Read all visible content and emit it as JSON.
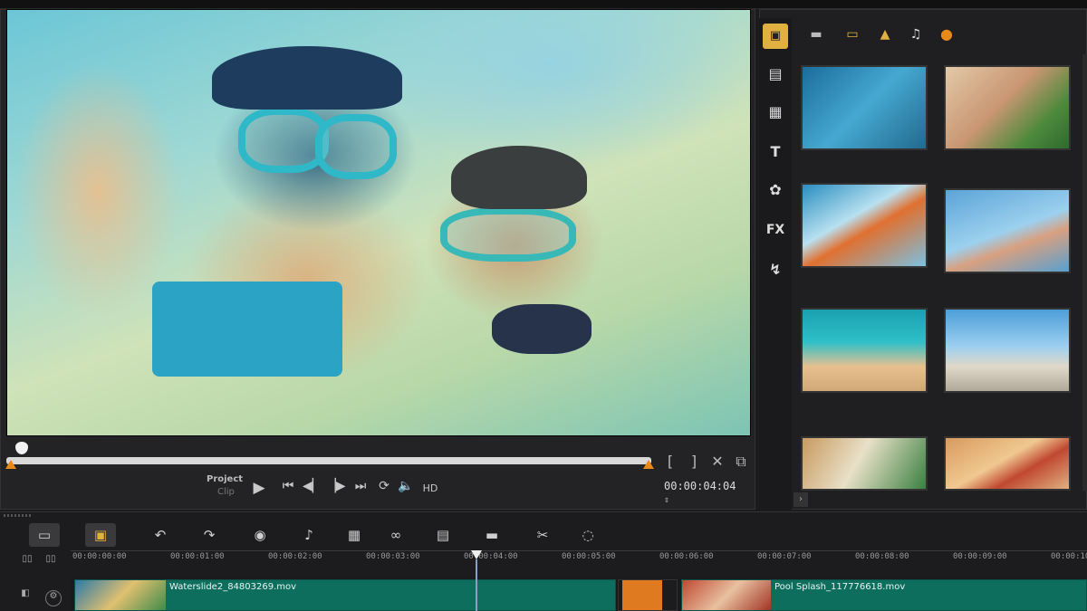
{
  "player": {
    "mode_project": "Project",
    "mode_clip": "Clip",
    "timecode": "00:00:04:04",
    "mark_in": "[",
    "mark_out": "]",
    "quality": "HD"
  },
  "library": {
    "side_fx_label": "FX",
    "side_title_label": "T",
    "thumbnails": [
      {
        "caption": ""
      },
      {
        "caption": ""
      },
      {
        "caption": ""
      },
      {
        "caption": ""
      },
      {
        "caption": ""
      },
      {
        "caption": ""
      },
      {
        "caption": ""
      },
      {
        "caption": ""
      }
    ]
  },
  "timeline": {
    "ruler_labels": [
      "00:00:00:00",
      "00:00:01:00",
      "00:00:02:00",
      "00:00:03:00",
      "00:00:04:00",
      "00:00:05:00",
      "00:00:06:00",
      "00:00:07:00",
      "00:00:08:00",
      "00:00:09:00",
      "00:00:10:00"
    ],
    "clips": [
      {
        "label": "Waterslide2_84803269.mov"
      },
      {
        "label": "Pool Splash_117776618.mov"
      }
    ]
  },
  "colors": {
    "accent": "#e88a1a",
    "clip": "#0e6e5e",
    "panel": "#232325"
  }
}
